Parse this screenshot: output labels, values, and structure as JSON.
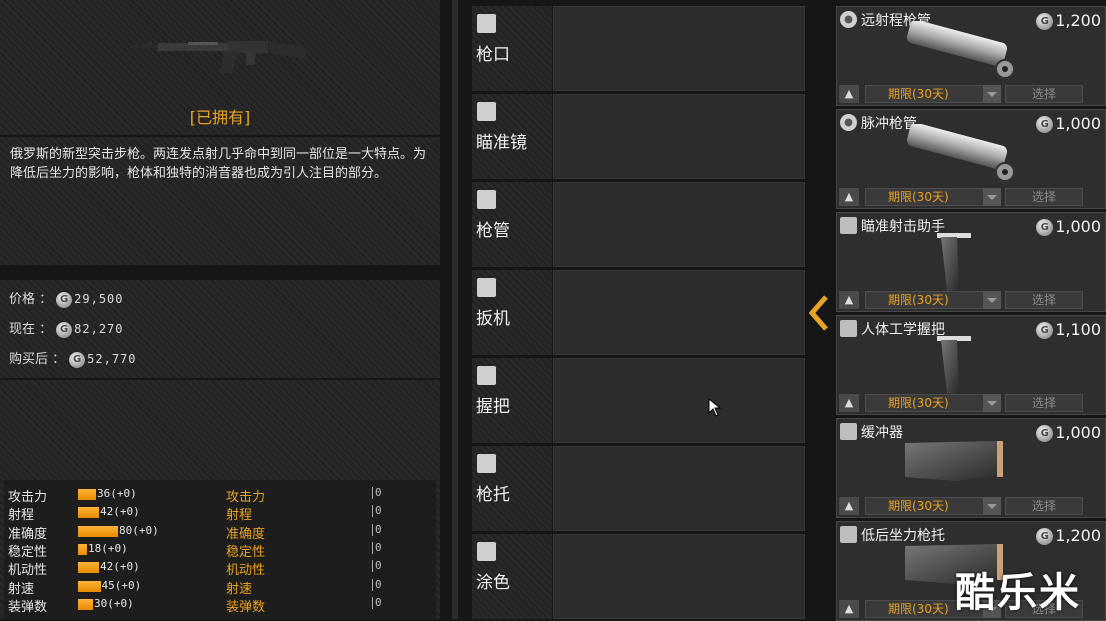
{
  "weapon": {
    "status": "[已拥有]",
    "description": "俄罗斯的新型突击步枪。两连发点射几乎命中到同一部位是一大特点。为降低后坐力的影响，枪体和独特的消音器也成为引人注目的部分。"
  },
  "prices": [
    {
      "label": "价格 ：",
      "value": "29,500"
    },
    {
      "label": "现在 ：",
      "value": "82,270"
    },
    {
      "label": "购买后 ：",
      "value": "52,770"
    }
  ],
  "coin_symbol": "G",
  "stats": [
    {
      "name": "攻击力",
      "bar": 36,
      "value": "36(+0)",
      "name2": "攻击力",
      "cmp": "0"
    },
    {
      "name": "射程",
      "bar": 42,
      "value": "42(+0)",
      "name2": "射程",
      "cmp": "0"
    },
    {
      "name": "准确度",
      "bar": 80,
      "value": "80(+0)",
      "name2": "准确度",
      "cmp": "0"
    },
    {
      "name": "稳定性",
      "bar": 18,
      "value": "18(+0)",
      "name2": "稳定性",
      "cmp": "0"
    },
    {
      "name": "机动性",
      "bar": 42,
      "value": "42(+0)",
      "name2": "机动性",
      "cmp": "0"
    },
    {
      "name": "射速",
      "bar": 45,
      "value": "45(+0)",
      "name2": "射速",
      "cmp": "0"
    },
    {
      "name": "装弹数",
      "bar": 30,
      "value": "30(+0)",
      "name2": "装弹数",
      "cmp": "0"
    }
  ],
  "slots": [
    {
      "label": "枪口",
      "icon": "muzzle-icon"
    },
    {
      "label": "瞄准镜",
      "icon": "scope-icon"
    },
    {
      "label": "枪管",
      "icon": "barrel-icon"
    },
    {
      "label": "扳机",
      "icon": "trigger-icon"
    },
    {
      "label": "握把",
      "icon": "grip-icon"
    },
    {
      "label": "枪托",
      "icon": "stock-icon"
    },
    {
      "label": "涂色",
      "icon": "paint-icon"
    }
  ],
  "items": [
    {
      "name": "远射程枪管",
      "price": "1,200",
      "term": "期限(30天)",
      "select": "选择",
      "icon": "barrel-icon"
    },
    {
      "name": "脉冲枪管",
      "price": "1,000",
      "term": "期限(30天)",
      "select": "选择",
      "icon": "barrel-icon"
    },
    {
      "name": "瞄准射击助手",
      "price": "1,000",
      "term": "期限(30天)",
      "select": "选择",
      "icon": "grip-icon"
    },
    {
      "name": "人体工学握把",
      "price": "1,100",
      "term": "期限(30天)",
      "select": "选择",
      "icon": "grip-icon"
    },
    {
      "name": "缓冲器",
      "price": "1,000",
      "term": "期限(30天)",
      "select": "选择",
      "icon": "stock-icon"
    },
    {
      "name": "低后坐力枪托",
      "price": "1,200",
      "term": "期限(30天)",
      "select": "选择",
      "icon": "stock-icon"
    }
  ],
  "watermark": "酷乐米",
  "colors": {
    "accent": "#e8a326",
    "bar": "#ffb43a",
    "panel": "#232323"
  }
}
